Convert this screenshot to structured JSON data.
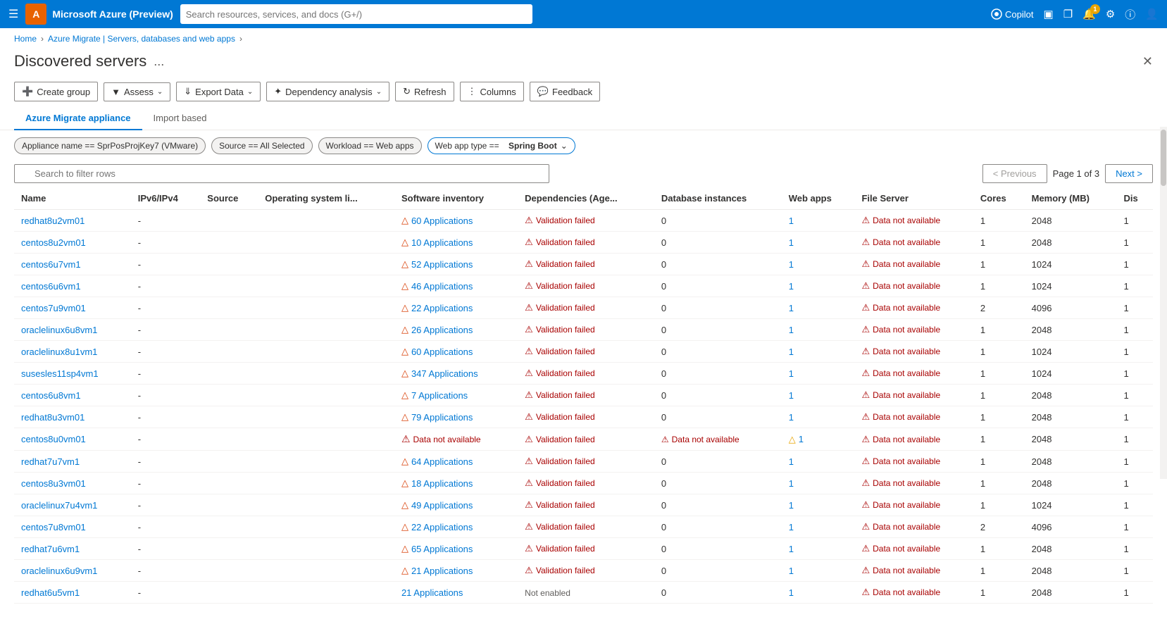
{
  "topbar": {
    "title": "Microsoft Azure (Preview)",
    "search_placeholder": "Search resources, services, and docs (G+/)",
    "copilot_label": "Copilot",
    "notification_count": "1"
  },
  "breadcrumb": {
    "home": "Home",
    "parent": "Azure Migrate | Servers, databases and web apps"
  },
  "page": {
    "title": "Discovered servers",
    "menu_label": "...",
    "close_label": "✕"
  },
  "toolbar": {
    "create_group": "Create group",
    "assess": "Assess",
    "export_data": "Export Data",
    "dependency_analysis": "Dependency analysis",
    "refresh": "Refresh",
    "columns": "Columns",
    "feedback": "Feedback"
  },
  "tabs": [
    {
      "label": "Azure Migrate appliance",
      "active": true
    },
    {
      "label": "Import based",
      "active": false
    }
  ],
  "filters": [
    {
      "label": "Appliance name == SprPosProjKey7 (VMware)",
      "has_dropdown": false
    },
    {
      "label": "Source == All Selected",
      "has_dropdown": false
    },
    {
      "label": "Workload == Web apps",
      "has_dropdown": false
    },
    {
      "label": "Web app type ==",
      "prefix": "Web app type ==",
      "value": "Spring Boot",
      "has_dropdown": true
    }
  ],
  "search": {
    "placeholder": "Search to filter rows"
  },
  "pagination": {
    "previous": "< Previous",
    "next": "Next >",
    "info": "Page 1 of 3"
  },
  "columns": [
    "Name",
    "IPv6/IPv4",
    "Source",
    "Operating system li...",
    "Software inventory",
    "Dependencies (Age...",
    "Database instances",
    "Web apps",
    "File Server",
    "Cores",
    "Memory (MB)",
    "Dis"
  ],
  "rows": [
    {
      "name": "redhat8u2vm01",
      "ip": "-",
      "source": "",
      "os": "",
      "software": "60 Applications",
      "software_warn": true,
      "deps": "Validation failed",
      "db": "0",
      "webapps": "1",
      "fileserver": "Data not available",
      "fileserver_err": true,
      "cores": "1",
      "memory": "2048",
      "dis": "1"
    },
    {
      "name": "centos8u2vm01",
      "ip": "-",
      "source": "",
      "os": "",
      "software": "10 Applications",
      "software_warn": true,
      "deps": "Validation failed",
      "db": "0",
      "webapps": "1",
      "fileserver": "Data not available",
      "fileserver_err": true,
      "cores": "1",
      "memory": "2048",
      "dis": "1"
    },
    {
      "name": "centos6u7vm1",
      "ip": "-",
      "source": "",
      "os": "",
      "software": "52 Applications",
      "software_warn": true,
      "deps": "Validation failed",
      "db": "0",
      "webapps": "1",
      "fileserver": "Data not available",
      "fileserver_err": true,
      "cores": "1",
      "memory": "1024",
      "dis": "1"
    },
    {
      "name": "centos6u6vm1",
      "ip": "-",
      "source": "",
      "os": "",
      "software": "46 Applications",
      "software_warn": true,
      "deps": "Validation failed",
      "db": "0",
      "webapps": "1",
      "fileserver": "Data not available",
      "fileserver_err": true,
      "cores": "1",
      "memory": "1024",
      "dis": "1"
    },
    {
      "name": "centos7u9vm01",
      "ip": "-",
      "source": "",
      "os": "",
      "software": "22 Applications",
      "software_warn": true,
      "deps": "Validation failed",
      "db": "0",
      "webapps": "1",
      "fileserver": "Data not available",
      "fileserver_err": true,
      "cores": "2",
      "memory": "4096",
      "dis": "1"
    },
    {
      "name": "oraclelinux6u8vm1",
      "ip": "-",
      "source": "",
      "os": "",
      "software": "26 Applications",
      "software_warn": true,
      "deps": "Validation failed",
      "db": "0",
      "webapps": "1",
      "fileserver": "Data not available",
      "fileserver_err": true,
      "cores": "1",
      "memory": "2048",
      "dis": "1"
    },
    {
      "name": "oraclelinux8u1vm1",
      "ip": "-",
      "source": "",
      "os": "",
      "software": "60 Applications",
      "software_warn": true,
      "deps": "Validation failed",
      "db": "0",
      "webapps": "1",
      "fileserver": "Data not available",
      "fileserver_err": true,
      "cores": "1",
      "memory": "1024",
      "dis": "1"
    },
    {
      "name": "susesles11sp4vm1",
      "ip": "-",
      "source": "",
      "os": "",
      "software": "347 Applications",
      "software_warn": true,
      "deps": "Validation failed",
      "db": "0",
      "webapps": "1",
      "fileserver": "Data not available",
      "fileserver_err": true,
      "cores": "1",
      "memory": "1024",
      "dis": "1"
    },
    {
      "name": "centos6u8vm1",
      "ip": "-",
      "source": "",
      "os": "",
      "software": "7 Applications",
      "software_warn": true,
      "deps": "Validation failed",
      "db": "0",
      "webapps": "1",
      "fileserver": "Data not available",
      "fileserver_err": true,
      "cores": "1",
      "memory": "2048",
      "dis": "1"
    },
    {
      "name": "redhat8u3vm01",
      "ip": "-",
      "source": "",
      "os": "",
      "software": "79 Applications",
      "software_warn": true,
      "deps": "Validation failed",
      "db": "0",
      "webapps": "1",
      "fileserver": "Data not available",
      "fileserver_err": true,
      "cores": "1",
      "memory": "2048",
      "dis": "1"
    },
    {
      "name": "centos8u0vm01",
      "ip": "-",
      "source": "",
      "os": "",
      "software": "Data not available",
      "software_warn": false,
      "software_err": true,
      "deps": "Validation failed",
      "db": "Data not available",
      "db_err": true,
      "webapps": "1",
      "webapps_warn": true,
      "fileserver": "Data not available",
      "fileserver_err": true,
      "cores": "1",
      "memory": "2048",
      "dis": "1"
    },
    {
      "name": "redhat7u7vm1",
      "ip": "-",
      "source": "",
      "os": "",
      "software": "64 Applications",
      "software_warn": true,
      "deps": "Validation failed",
      "db": "0",
      "webapps": "1",
      "fileserver": "Data not available",
      "fileserver_err": true,
      "cores": "1",
      "memory": "2048",
      "dis": "1"
    },
    {
      "name": "centos8u3vm01",
      "ip": "-",
      "source": "",
      "os": "",
      "software": "18 Applications",
      "software_warn": true,
      "deps": "Validation failed",
      "db": "0",
      "webapps": "1",
      "fileserver": "Data not available",
      "fileserver_err": true,
      "cores": "1",
      "memory": "2048",
      "dis": "1"
    },
    {
      "name": "oraclelinux7u4vm1",
      "ip": "-",
      "source": "",
      "os": "",
      "software": "49 Applications",
      "software_warn": true,
      "deps": "Validation failed",
      "db": "0",
      "webapps": "1",
      "fileserver": "Data not available",
      "fileserver_err": true,
      "cores": "1",
      "memory": "1024",
      "dis": "1"
    },
    {
      "name": "centos7u8vm01",
      "ip": "-",
      "source": "",
      "os": "",
      "software": "22 Applications",
      "software_warn": true,
      "deps": "Validation failed",
      "db": "0",
      "webapps": "1",
      "fileserver": "Data not available",
      "fileserver_err": true,
      "cores": "2",
      "memory": "4096",
      "dis": "1"
    },
    {
      "name": "redhat7u6vm1",
      "ip": "-",
      "source": "",
      "os": "",
      "software": "65 Applications",
      "software_warn": true,
      "deps": "Validation failed",
      "db": "0",
      "webapps": "1",
      "fileserver": "Data not available",
      "fileserver_err": true,
      "cores": "1",
      "memory": "2048",
      "dis": "1"
    },
    {
      "name": "oraclelinux6u9vm1",
      "ip": "-",
      "source": "",
      "os": "",
      "software": "21 Applications",
      "software_warn": true,
      "deps": "Validation failed",
      "db": "0",
      "webapps": "1",
      "fileserver": "Data not available",
      "fileserver_err": true,
      "cores": "1",
      "memory": "2048",
      "dis": "1"
    },
    {
      "name": "redhat6u5vm1",
      "ip": "-",
      "source": "",
      "os": "",
      "software": "21 Applications",
      "software_warn": false,
      "deps": "Not enabled",
      "deps_not_enabled": true,
      "db": "0",
      "webapps": "1",
      "fileserver": "Data not available",
      "fileserver_err": true,
      "cores": "1",
      "memory": "2048",
      "dis": "1"
    }
  ]
}
